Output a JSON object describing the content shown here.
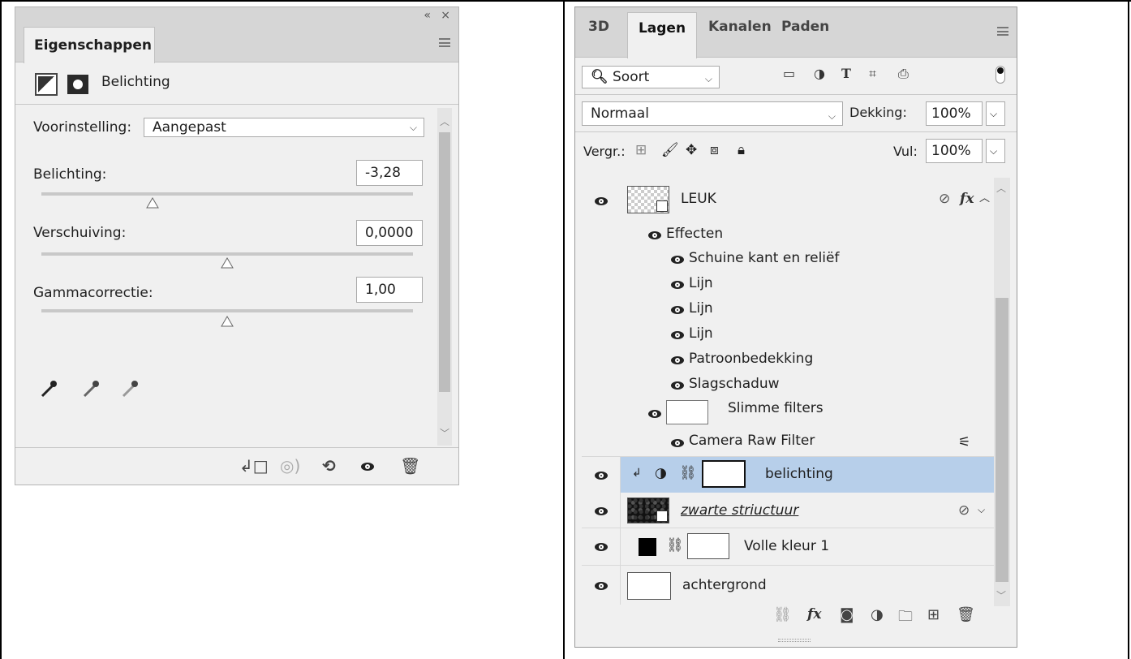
{
  "properties_panel": {
    "collapse_glyph": "«",
    "close_glyph": "×",
    "tab_label": "Eigenschappen",
    "header_title": "Belichting",
    "preset": {
      "label": "Voorinstelling:",
      "value": "Aangepast"
    },
    "exposure": {
      "label": "Belichting:",
      "value": "-3,28",
      "slider_fraction": 0.3
    },
    "offset": {
      "label": "Verschuiving:",
      "value": "0,0000",
      "slider_fraction": 0.5
    },
    "gamma": {
      "label": "Gammacorrectie:",
      "value": "1,00",
      "slider_fraction": 0.5
    },
    "bottom_icons": [
      "clip-to-layer-icon",
      "view-previous-icon",
      "reset-icon",
      "visibility-eye-icon",
      "trash-icon"
    ]
  },
  "layers_panel": {
    "tabs": [
      "3D",
      "Lagen",
      "Kanalen",
      "Paden"
    ],
    "active_tab": "Lagen",
    "filter": {
      "value": "Soort"
    },
    "filter_icons": [
      "image-filter-icon",
      "adjustment-filter-icon",
      "type-filter-icon",
      "shape-filter-icon",
      "smart-object-filter-icon"
    ],
    "blend_mode": "Normaal",
    "opacity": {
      "label": "Dekking:",
      "value": "100%"
    },
    "lock_label": "Vergr.:",
    "fill": {
      "label": "Vul:",
      "value": "100%"
    },
    "layers": {
      "leuk": "LEUK",
      "effects": "Effecten",
      "effect_items": [
        "Schuine kant en reliëf",
        "Lijn",
        "Lijn",
        "Lijn",
        "Patroonbedekking",
        "Slagschaduw"
      ],
      "smart_filters": "Slimme filters",
      "camera_raw": "Camera Raw Filter",
      "belichting": "belichting",
      "zwarte": "zwarte striuctuur",
      "volle": "Volle kleur 1",
      "achtergrond": "achtergrond"
    },
    "bottom_icons": [
      "link-layers-icon",
      "fx-icon",
      "add-mask-icon",
      "new-adjustment-icon",
      "new-group-icon",
      "new-layer-icon",
      "delete-layer-icon"
    ]
  },
  "colors": {
    "selection": "#b7cfea",
    "panel_bg": "#f0f0f0",
    "tab_bar_bg": "#d6d6d6"
  }
}
